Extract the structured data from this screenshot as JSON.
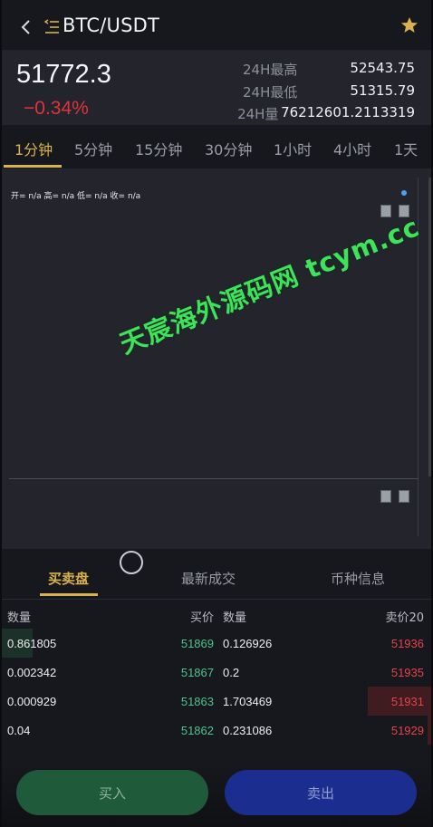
{
  "header": {
    "title": "BTC/USDT"
  },
  "ticker": {
    "last_price": "51772.3",
    "change": "−0.34%",
    "high_label": "24H最高",
    "high_value": "52543.75",
    "low_label": "24H最低",
    "low_value": "51315.79",
    "volume_label": "24H量",
    "volume_value": "76212601.2113319"
  },
  "timeframes": [
    "1分钟",
    "5分钟",
    "15分钟",
    "30分钟",
    "1小时",
    "4小时",
    "1天"
  ],
  "chart": {
    "ohlc": "开= n/a  高= n/a  低= n/a  收= n/a",
    "watermark": "天宸海外源码网 tcym.cc"
  },
  "tabs": [
    "买卖盘",
    "最新成交",
    "币种信息"
  ],
  "book": {
    "headers": {
      "bid_qty": "数量",
      "bid_price": "买价",
      "ask_qty": "数量",
      "ask_price": "卖价20"
    },
    "rows": [
      {
        "bid_qty": "0.861805",
        "bid_price": "51869",
        "ask_qty": "0.126926",
        "ask_price": "51936"
      },
      {
        "bid_qty": "0.002342",
        "bid_price": "51867",
        "ask_qty": "0.2",
        "ask_price": "51935"
      },
      {
        "bid_qty": "0.000929",
        "bid_price": "51863",
        "ask_qty": "1.703469",
        "ask_price": "51931"
      },
      {
        "bid_qty": "0.04",
        "bid_price": "51862",
        "ask_qty": "0.231086",
        "ask_price": "51929"
      }
    ]
  },
  "actions": {
    "buy": "买入",
    "sell": "卖出"
  },
  "colors": {
    "accent": "#d8b24e",
    "up": "#4cc38a",
    "down": "#e8414a"
  }
}
